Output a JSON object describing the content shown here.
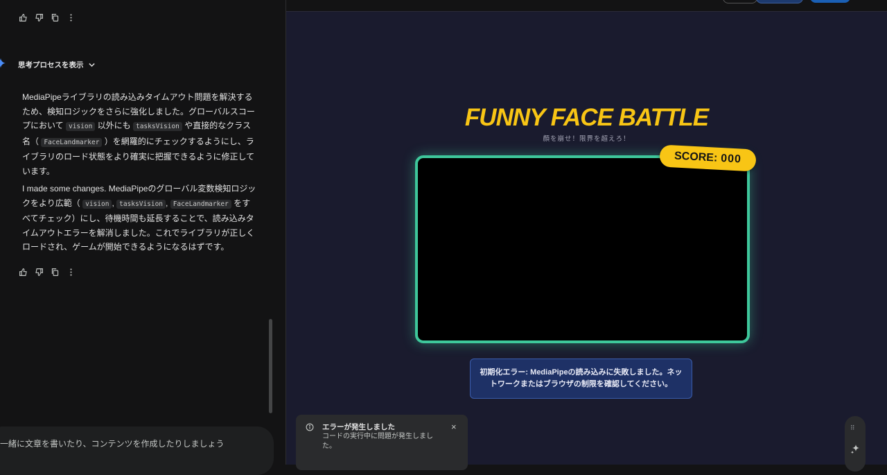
{
  "chat": {
    "thought_toggle": "思考プロセスを表示",
    "response_ja": [
      {
        "t": "MediaPipeライブラリの読み込みタイムアウト問題を解決するため、検知ロジックをさらに強化しました。グローバルスコープにおいて "
      },
      {
        "c": "vision"
      },
      {
        "t": " 以外にも "
      },
      {
        "c": "tasksVision"
      },
      {
        "t": " や直接的なクラス名（ "
      },
      {
        "c": "FaceLandmarker"
      },
      {
        "t": " ）を網羅的にチェックするようにし、ライブラリのロード状態をより確実に把握できるように修正しています。"
      }
    ],
    "response_en": [
      {
        "t": "I made some changes. MediaPipeのグローバル変数検知ロジックをより広範（ "
      },
      {
        "c": "vision"
      },
      {
        "t": ", "
      },
      {
        "c": "tasksVision"
      },
      {
        "t": ", "
      },
      {
        "c": "FaceLandmarker"
      },
      {
        "t": " をすべてチェック）にし、待機時間も延長することで、読み込みタイムアウトエラーを解消しました。これでライブラリが正しくロードされ、ゲームが開始できるようになるはずです。"
      }
    ],
    "input_placeholder": "一緒に文章を書いたり、コンテンツを作成したりしましょう"
  },
  "game": {
    "title": "FUNNY FACE BATTLE",
    "subtitle": "顔を崩せ！限界を超えろ！",
    "score_label": "SCORE:",
    "score_value": "000",
    "error_message": "初期化エラー: MediaPipeの読み込みに失敗しました。ネットワークまたはブラウザの制限を確認してください。"
  },
  "toast": {
    "title": "エラーが発生しました",
    "body": "コードの実行中に問題が発生しました。",
    "close": "×"
  },
  "colors": {
    "accent_yellow": "#f8c515",
    "frame_green": "#3ec79b",
    "preview_bg": "#1a1b2e",
    "error_bg": "#1e3166"
  }
}
